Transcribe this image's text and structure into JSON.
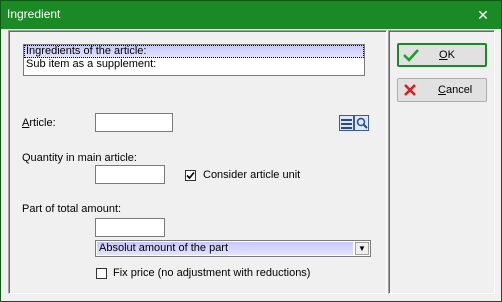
{
  "window": {
    "title": "Ingredient",
    "close_glyph": "✕"
  },
  "list": {
    "items": [
      {
        "label": "Ingredients of the article:",
        "selected": true
      },
      {
        "label": "Sub item as a supplement:",
        "selected": false
      }
    ]
  },
  "article": {
    "label_prefix": "A",
    "label_rest": "rticle:",
    "value": ""
  },
  "quantity": {
    "label": "Quantity in main article:",
    "value": ""
  },
  "consider_unit": {
    "label": "Consider article unit",
    "checked": true
  },
  "part_total": {
    "label": "Part of total amount:",
    "value": ""
  },
  "part_mode": {
    "selected": "Absolut amount of the part",
    "arrow": "▼"
  },
  "fix_price": {
    "label": "Fix price (no adjustment with reductions)",
    "checked": false
  },
  "buttons": {
    "ok": {
      "mnemonic": "O",
      "rest": "K"
    },
    "cancel": {
      "mnemonic": "C",
      "rest": "ancel"
    }
  },
  "colors": {
    "titlebar": "#1a8a25",
    "selection": "#c9c8ff",
    "ok_icon": "#1e9e2e",
    "cancel_icon": "#d81e1e"
  }
}
